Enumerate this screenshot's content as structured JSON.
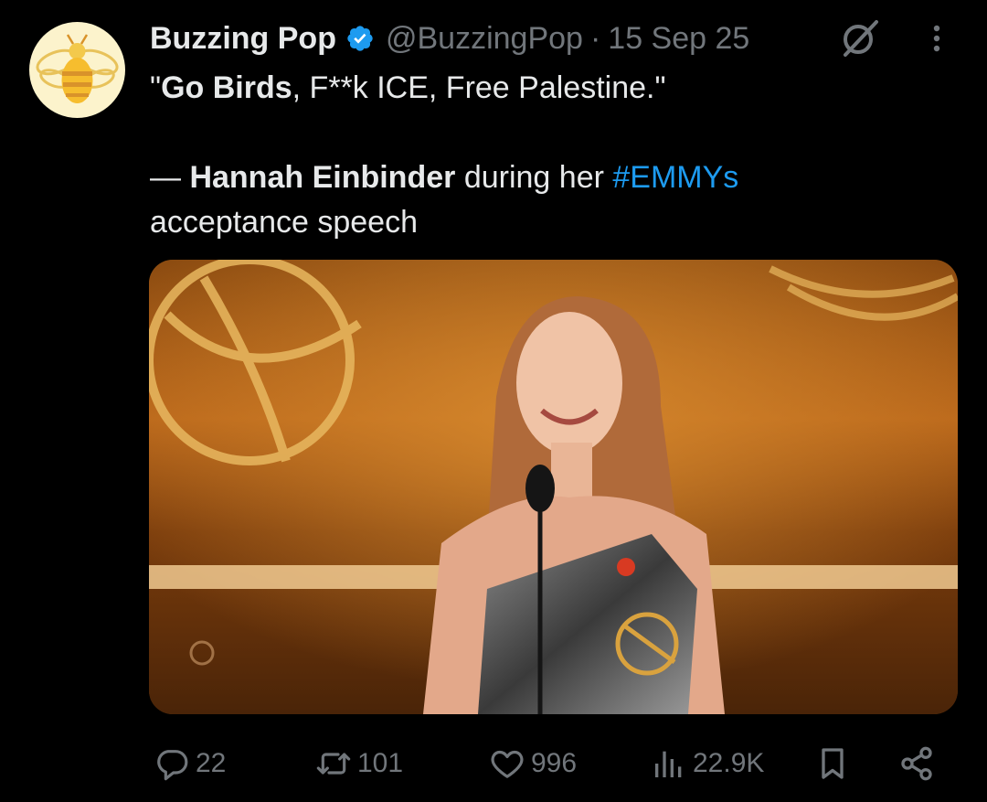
{
  "author": {
    "display_name": "Buzzing Pop",
    "handle": "@BuzzingPop",
    "separator": "·",
    "timestamp": "15 Sep 25",
    "avatar_icon": "bee-icon",
    "verified_color": "#1d9bf0"
  },
  "tweet": {
    "line1": {
      "quote_open": "\"",
      "bold": "Go Birds",
      "rest": ", F**k ICE, Free Palestine.\""
    },
    "line2": {
      "dash": "— ",
      "bold_name": "Hannah Einbinder",
      "middle": " during her ",
      "hashtag": "#EMMYs"
    },
    "line3": "acceptance speech"
  },
  "media": {
    "type": "video",
    "description_icon": "video-thumbnail"
  },
  "actions": {
    "replies": "22",
    "reposts": "101",
    "likes": "996",
    "views": "22.9K"
  },
  "colors": {
    "background": "#000000",
    "text": "#e7e9ea",
    "muted": "#71767b",
    "link": "#1d9bf0"
  }
}
